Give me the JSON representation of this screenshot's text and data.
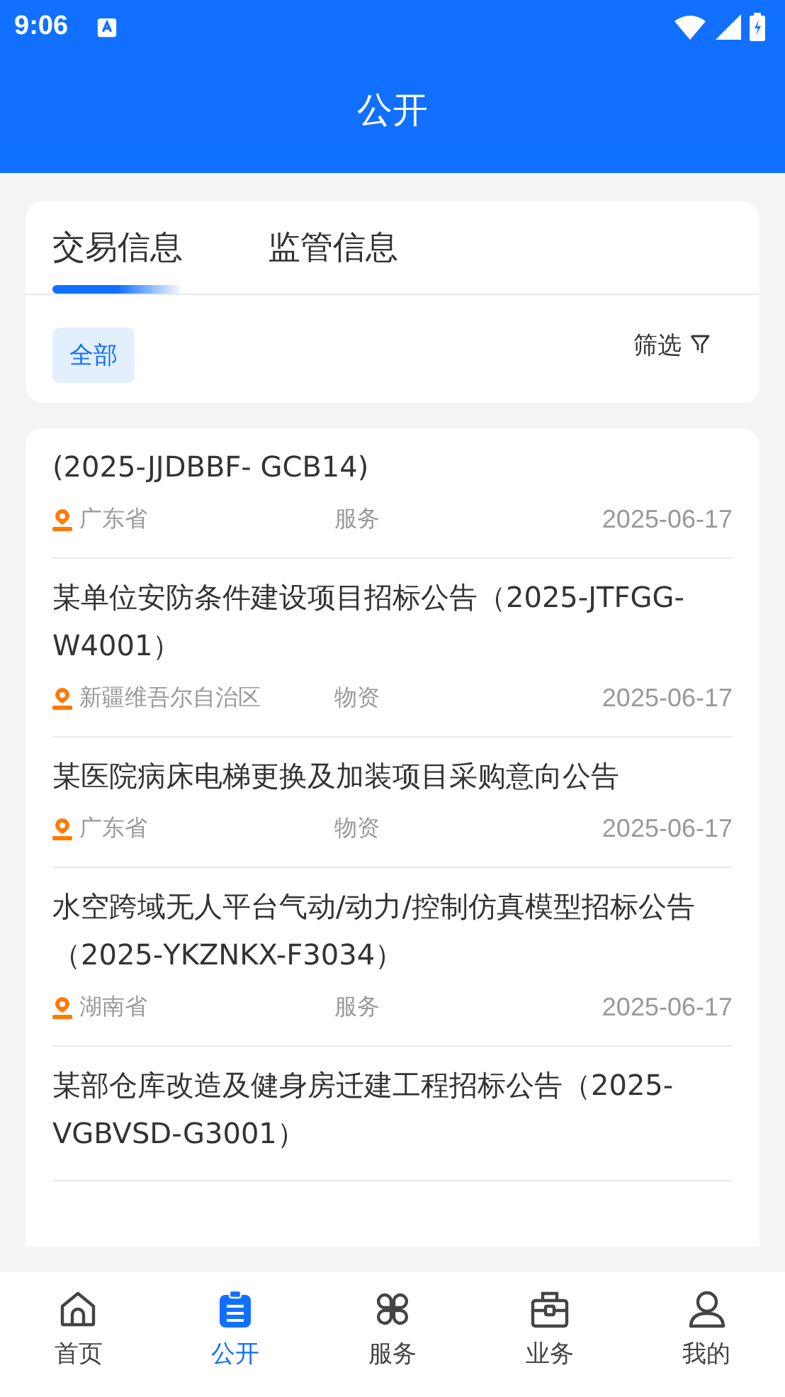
{
  "status_bar": {
    "time": "9:06"
  },
  "header": {
    "title": "公开"
  },
  "tabs": [
    {
      "label": "交易信息",
      "selected": true
    },
    {
      "label": "监管信息",
      "selected": false
    }
  ],
  "filter_chips": [
    {
      "label": "全部",
      "selected": true
    }
  ],
  "filter_button": {
    "label": "筛选"
  },
  "items": [
    {
      "title": "(2025-JJDBBF- GCB14)",
      "region": "广东省",
      "category": "服务",
      "date": "2025-06-17"
    },
    {
      "title": "某单位安防条件建设项目招标公告（2025-JTFGG-W4001）",
      "region": "新疆维吾尔自治区",
      "category": "物资",
      "date": "2025-06-17"
    },
    {
      "title": "某医院病床电梯更换及加装项目采购意向公告",
      "region": "广东省",
      "category": "物资",
      "date": "2025-06-17"
    },
    {
      "title": "水空跨域无人平台气动/动力/控制仿真模型招标公告（2025-YKZNKX-F3034）",
      "region": "湖南省",
      "category": "服务",
      "date": "2025-06-17"
    },
    {
      "title": "某部仓库改造及健身房迁建工程招标公告（2025-VGBVSD-G3001）"
    }
  ],
  "nav": [
    {
      "label": "首页",
      "kind": "home",
      "selected": false
    },
    {
      "label": "公开",
      "kind": "clipboard",
      "selected": true
    },
    {
      "label": "服务",
      "kind": "grid",
      "selected": false
    },
    {
      "label": "业务",
      "kind": "toolbox",
      "selected": false
    },
    {
      "label": "我的",
      "kind": "person",
      "selected": false
    }
  ]
}
